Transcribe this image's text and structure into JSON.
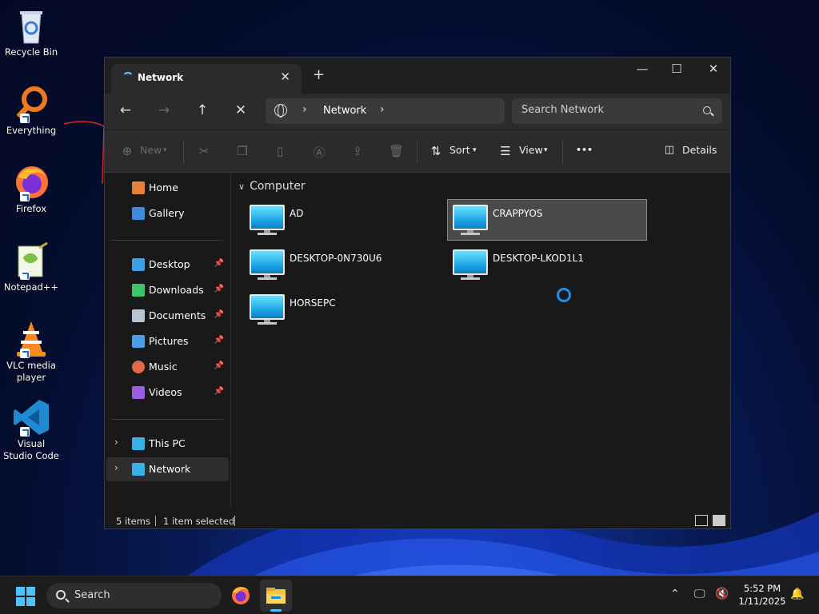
{
  "desktop": {
    "icons": [
      {
        "label": "Recycle Bin",
        "icon": "recycle-bin-icon"
      },
      {
        "label": "Everything",
        "icon": "everything-search-icon"
      },
      {
        "label": "Firefox",
        "icon": "firefox-icon"
      },
      {
        "label": "Notepad++",
        "icon": "notepad-plus-plus-icon"
      },
      {
        "label": "VLC media player",
        "icon": "vlc-icon"
      },
      {
        "label": "Visual Studio Code",
        "icon": "vscode-icon"
      }
    ]
  },
  "window": {
    "tab_title": "Network",
    "new_tab": "+",
    "controls": {
      "minimize": "—",
      "maximize": "☐",
      "close": "✕"
    }
  },
  "navbar": {
    "back": "←",
    "forward": "→",
    "up": "↑",
    "stop": "✕",
    "breadcrumb": "Network",
    "search_placeholder": "Search Network"
  },
  "toolbar": {
    "new_label": "New",
    "sort_label": "Sort",
    "view_label": "View",
    "more_label": "•••",
    "details_label": "Details"
  },
  "sidebar": {
    "top": [
      {
        "label": "Home",
        "icon": "home-icon",
        "color": "#e8803a"
      },
      {
        "label": "Gallery",
        "icon": "gallery-icon",
        "color": "#3f8ae0"
      }
    ],
    "pinned": [
      {
        "label": "Desktop",
        "icon": "desktop-folder-icon",
        "color": "#3aa0e8"
      },
      {
        "label": "Downloads",
        "icon": "downloads-icon",
        "color": "#3ec46d"
      },
      {
        "label": "Documents",
        "icon": "documents-icon",
        "color": "#b8c4d4"
      },
      {
        "label": "Pictures",
        "icon": "pictures-icon",
        "color": "#4a9ee8"
      },
      {
        "label": "Music",
        "icon": "music-icon",
        "color": "#e06a48"
      },
      {
        "label": "Videos",
        "icon": "videos-icon",
        "color": "#9b5de5"
      }
    ],
    "bottom": [
      {
        "label": "This PC",
        "icon": "this-pc-icon",
        "color": "#3ab0e8"
      },
      {
        "label": "Network",
        "icon": "network-icon",
        "color": "#3ab0e8"
      }
    ]
  },
  "content": {
    "group": "Computer",
    "items": [
      {
        "name": "AD",
        "selected": false
      },
      {
        "name": "CRAPPYOS",
        "selected": true
      },
      {
        "name": "DESKTOP-0N730U6",
        "selected": false
      },
      {
        "name": "DESKTOP-LKOD1L1",
        "selected": false
      },
      {
        "name": "HORSEPC",
        "selected": false
      }
    ]
  },
  "status": {
    "item_count": "5 items",
    "selection": "1 item selected"
  },
  "taskbar": {
    "search_label": "Search",
    "time": "5:52 PM",
    "date": "1/11/2025",
    "accent": "#4cc2ff"
  }
}
